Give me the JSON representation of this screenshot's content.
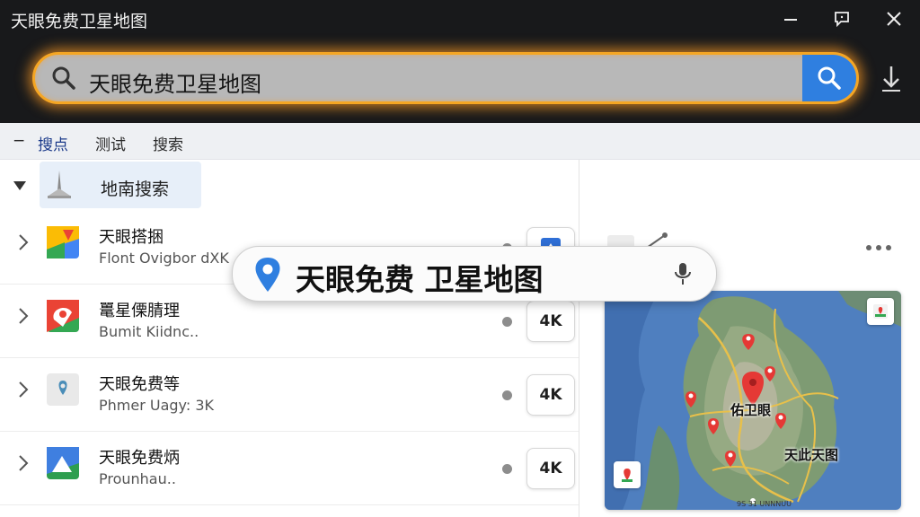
{
  "window": {
    "title": "天眼免费卫星地图"
  },
  "search": {
    "value": "天眼免费卫星地图"
  },
  "menubar": {
    "collapse": "−",
    "items": [
      {
        "label": "搜点",
        "active": true
      },
      {
        "label": "测试",
        "active": false
      },
      {
        "label": "搜索",
        "active": false
      }
    ]
  },
  "group": {
    "label": "地南搜索"
  },
  "rows": [
    {
      "title": "天眼搭捆",
      "subtitle": "Flont Ovigbor dXK",
      "badge": "",
      "icon": "maps-app-icon"
    },
    {
      "title": "鼍星傈腈理",
      "subtitle": "Bumit Kiidnc..",
      "badge": "4K",
      "icon": "red-pin-app-icon"
    },
    {
      "title": "天眼免费等",
      "subtitle": "Phmer Uagy: 3K",
      "badge": "4K",
      "icon": "location-app-icon"
    },
    {
      "title": "天眼免费炳",
      "subtitle": "Prounhau..",
      "badge": "4K",
      "icon": "mountain-app-icon"
    }
  ],
  "overlay": {
    "text": "天眼免费 卫星地图"
  },
  "map": {
    "labels": [
      "佑卫眼",
      "天此天图"
    ],
    "footer": "9S 31 UNNNUU"
  },
  "colors": {
    "accent": "#2f7fe0",
    "glow": "#f5a623",
    "header": "#18191b"
  }
}
